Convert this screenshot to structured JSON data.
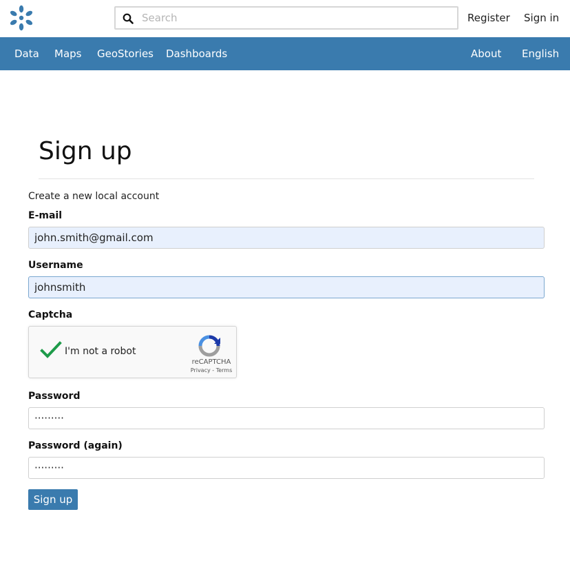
{
  "header": {
    "search_placeholder": "Search",
    "register": "Register",
    "signin": "Sign in"
  },
  "nav": {
    "items": [
      "Data",
      "Maps",
      "GeoStories",
      "Dashboards"
    ],
    "right": [
      "About",
      "English"
    ]
  },
  "form": {
    "title": "Sign up",
    "subtitle": "Create a new local account",
    "email_label": "E-mail",
    "email_value": "john.smith@gmail.com",
    "username_label": "Username",
    "username_value": "johnsmith",
    "captcha_label": "Captcha",
    "captcha_text": "I'm not a robot",
    "captcha_brand": "reCAPTCHA",
    "captcha_links": "Privacy - Terms",
    "password_label": "Password",
    "password_value": "·········",
    "password2_label": "Password (again)",
    "password2_value": "·········",
    "submit": "Sign up"
  },
  "colors": {
    "nav_bg": "#3a7bae",
    "logo": "#3a7bae",
    "checkmark": "#1e9b4a"
  },
  "icons": {
    "logo": "geonode-logo-icon",
    "search": "search-icon",
    "check": "checkmark-icon",
    "recaptcha": "recaptcha-icon"
  }
}
